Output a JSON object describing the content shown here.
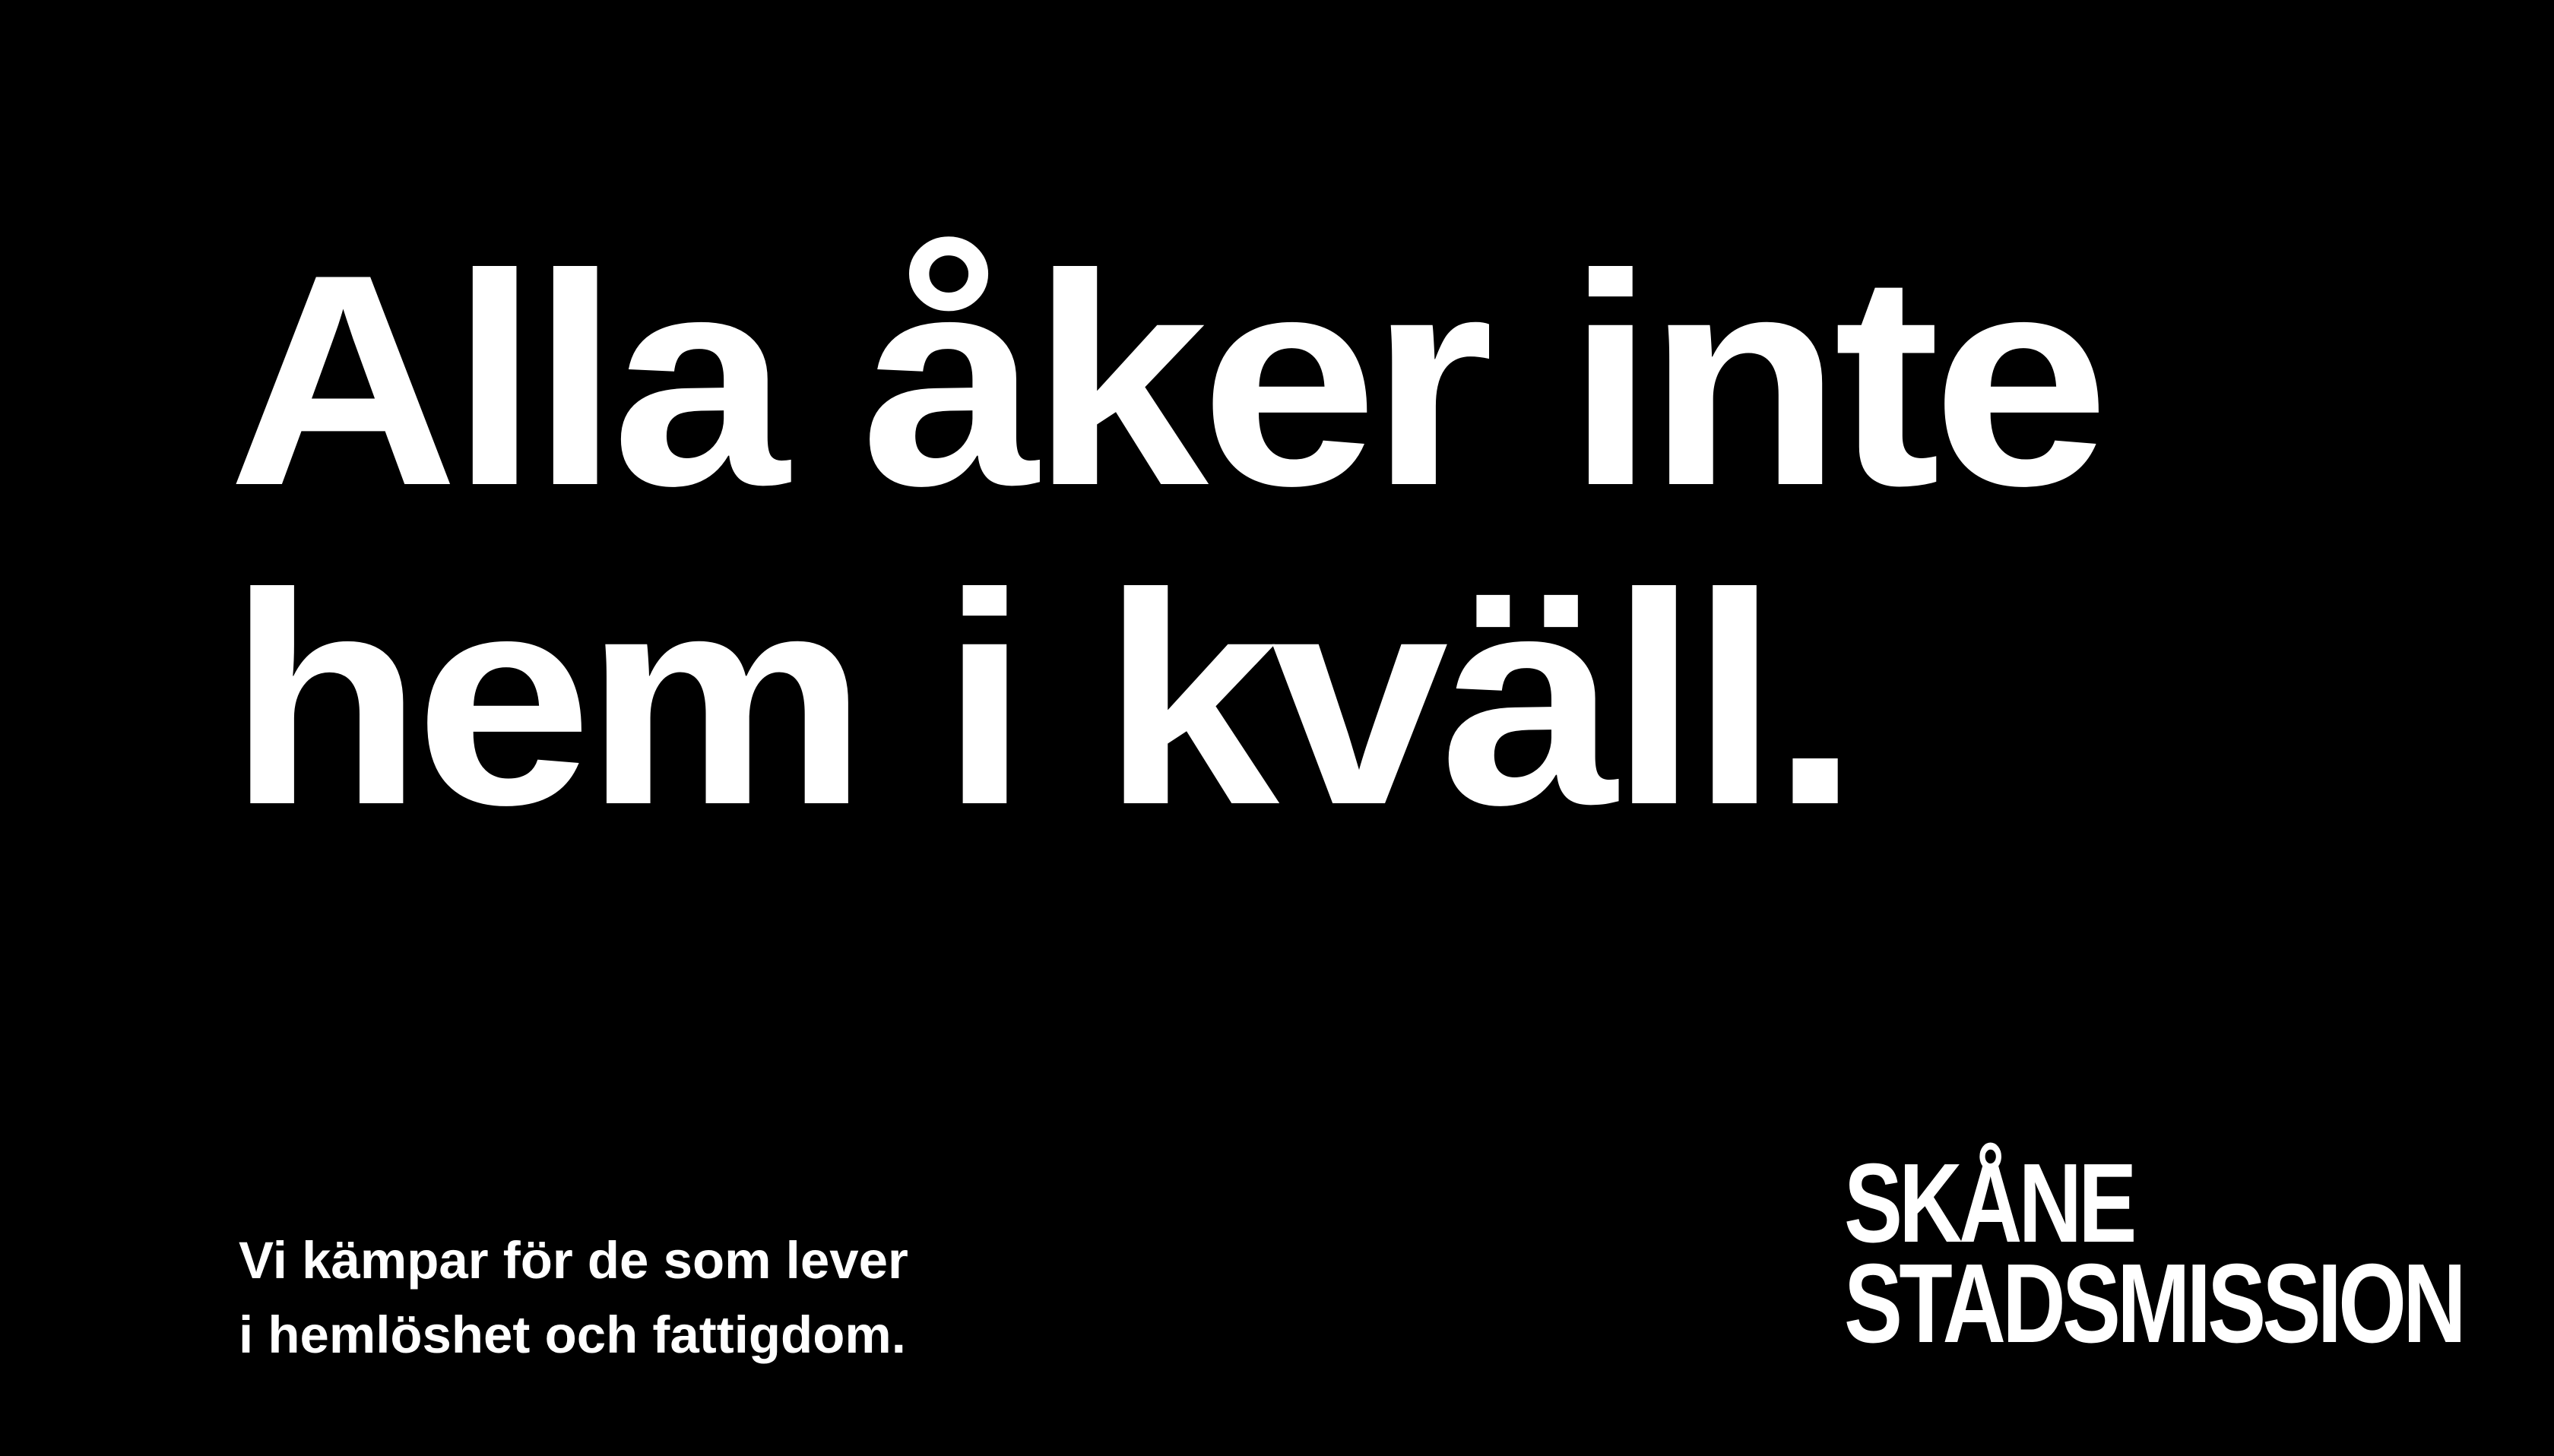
{
  "colors": {
    "background": "#000000",
    "text": "#ffffff"
  },
  "headline": {
    "line1": "Alla åker inte",
    "line2": "hem i kväll."
  },
  "tagline": {
    "line1": "Vi kämpar för de som lever",
    "line2": "i hemlöshet och fattigdom."
  },
  "logo": {
    "line1": "SKÅNE",
    "line2": "STADSMISSION"
  }
}
